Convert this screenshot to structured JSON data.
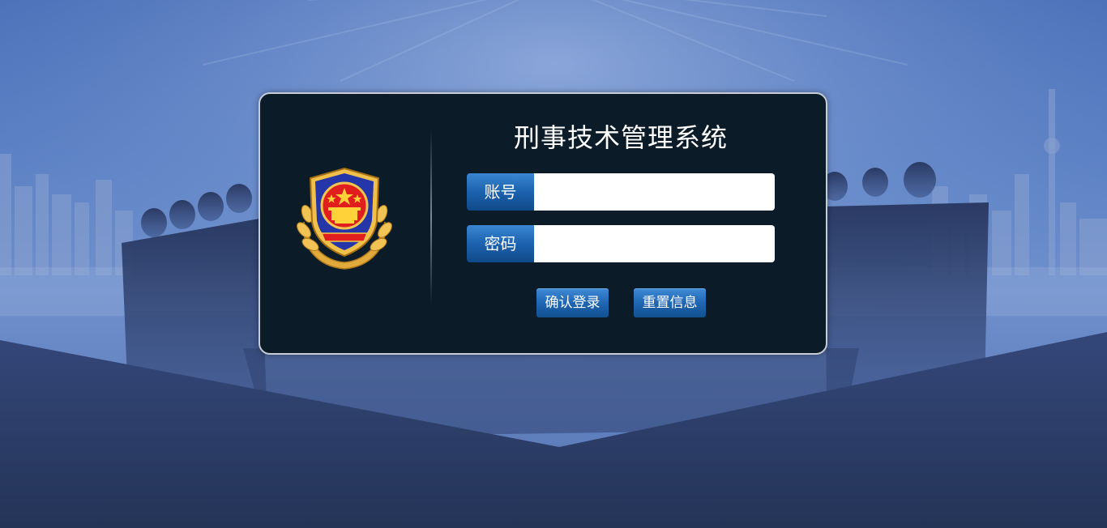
{
  "app": {
    "title": "刑事技术管理系统"
  },
  "form": {
    "account": {
      "label": "账号",
      "value": "",
      "placeholder": ""
    },
    "password": {
      "label": "密码",
      "value": "",
      "placeholder": ""
    }
  },
  "buttons": {
    "confirm_label": "确认登录",
    "reset_label": "重置信息"
  },
  "icons": {
    "emblem": "police-emblem-icon"
  },
  "colors": {
    "panel_bg": "#0b1b28",
    "button_blue": "#1f66b3",
    "background_blue": "#5b80c4",
    "footer_navy": "#2b3a63"
  }
}
